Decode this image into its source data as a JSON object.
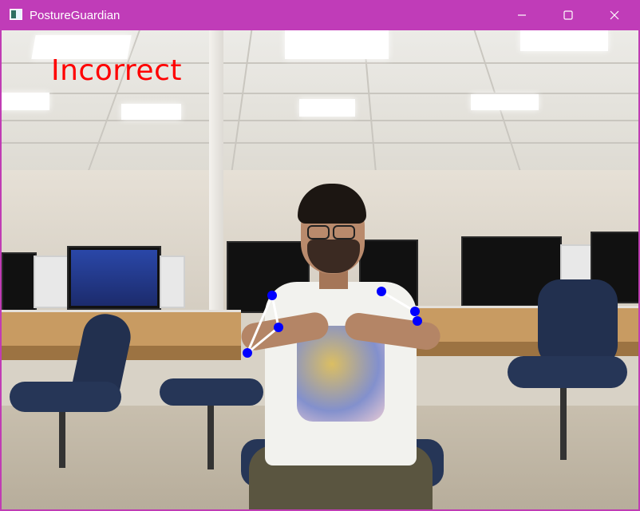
{
  "window": {
    "title": "PostureGuardian",
    "titlebar_color": "#c03cb8"
  },
  "feed": {
    "status_text": "Incorrect",
    "status_color": "#ff0000",
    "keypoint_color": "#0000ff",
    "skeleton_color": "#ffffff"
  },
  "icons": {
    "app": "camera-window-icon",
    "minimize": "minimize-icon",
    "maximize": "maximize-icon",
    "close": "close-icon"
  }
}
